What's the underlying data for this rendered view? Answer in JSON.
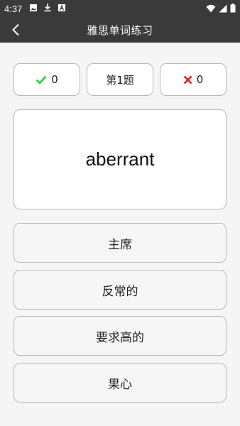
{
  "status": {
    "time": "4:37",
    "icons": [
      "image-icon",
      "download-icon",
      "app-icon",
      "wifi-icon",
      "signal-icon",
      "battery-icon"
    ]
  },
  "header": {
    "title": "雅思单词练习",
    "back_icon": "chevron-left-icon"
  },
  "score": {
    "correct_count": "0",
    "question_label": "第1题",
    "wrong_count": "0"
  },
  "word": "aberrant",
  "options": [
    "主席",
    "反常的",
    "要求高的",
    "果心"
  ],
  "colors": {
    "bar": "#3a3a3a",
    "correct": "#2ecc40",
    "wrong": "#e02020"
  }
}
